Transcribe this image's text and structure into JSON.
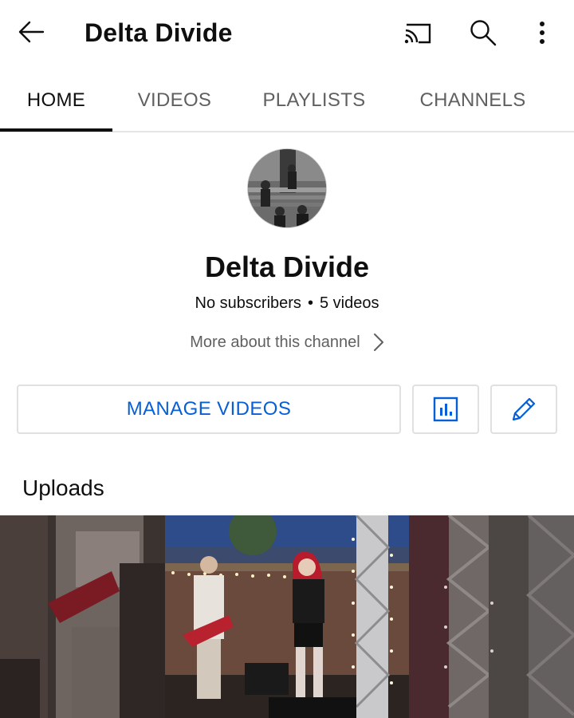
{
  "header": {
    "title": "Delta Divide",
    "icons": [
      "arrow-back-icon",
      "cast-icon",
      "search-icon",
      "more-vert-icon"
    ]
  },
  "tabs": [
    {
      "label": "HOME",
      "active": true
    },
    {
      "label": "VIDEOS",
      "active": false
    },
    {
      "label": "PLAYLISTS",
      "active": false
    },
    {
      "label": "CHANNELS",
      "active": false
    }
  ],
  "channel": {
    "name": "Delta Divide",
    "subscribers": "No subscribers",
    "separator": "•",
    "videos": "5 videos",
    "more_about": "More about this channel"
  },
  "actions": {
    "manage_label": "MANAGE VIDEOS",
    "icons": [
      "analytics-icon",
      "edit-pencil-icon"
    ]
  },
  "uploads": {
    "heading": "Uploads"
  },
  "colors": {
    "accent": "#065fd4",
    "text_primary": "#0f0f0f",
    "text_secondary": "#606060",
    "divider": "#e5e5e5"
  }
}
